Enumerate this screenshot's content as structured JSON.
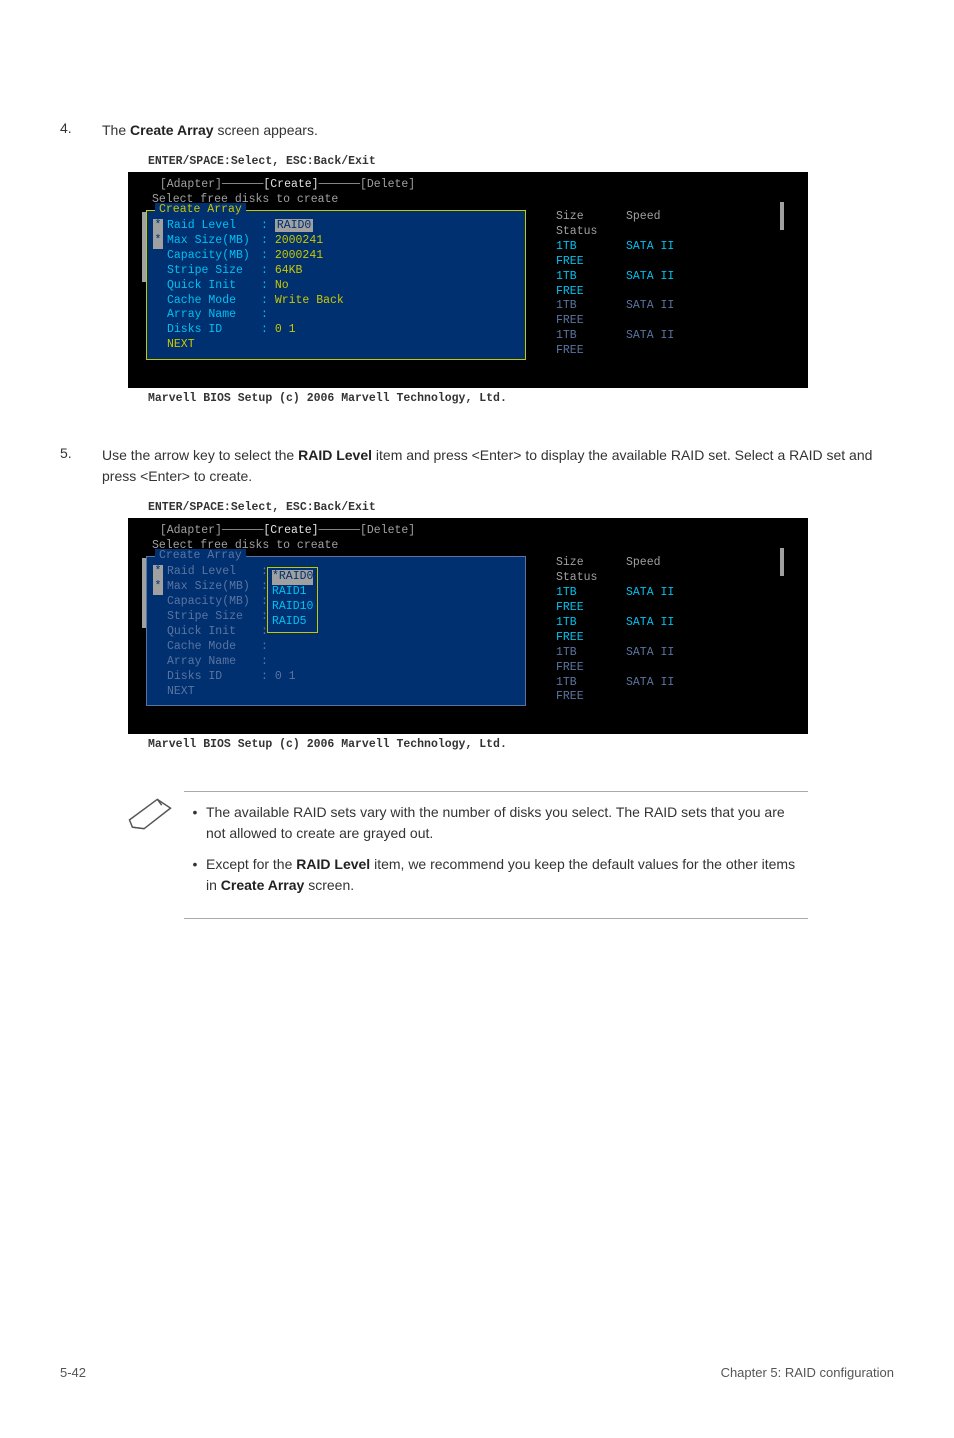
{
  "step4": {
    "num": "4.",
    "text_a": "The",
    "bold": "Create Array",
    "text_b": "screen appears."
  },
  "step5": {
    "num": "5.",
    "text_a": "Use the arrow key to select the",
    "bold": "RAID Level",
    "text_b": "item and press <Enter> to display the available RAID set. Select a RAID set and press <Enter> to create."
  },
  "bios": {
    "header": "ENTER/SPACE:Select, ESC:Back/Exit",
    "tabs": {
      "adapter": "[Adapter]",
      "create": "[Create]",
      "delete": "[Delete]"
    },
    "subtitle": "Select free disks to create",
    "panel_title": "Create Array",
    "fields": {
      "raid_level": "Raid Level",
      "max_size": "Max Size(MB)",
      "capacity": "Capacity(MB)",
      "stripe": "Stripe Size",
      "quick": "Quick Init",
      "cache": "Cache Mode",
      "array": "Array Name",
      "disks": "Disks ID",
      "next": "NEXT"
    },
    "values": {
      "raid_level": "RAID0",
      "max_size": "2000241",
      "capacity": "2000241",
      "stripe": "64KB",
      "quick": "No",
      "cache": "Write Back",
      "array": "",
      "disks": "0 1"
    },
    "dropdown": {
      "o0": "*RAID0",
      "o1": " RAID1",
      "o2": " RAID10",
      "o3": " RAID5"
    },
    "table": {
      "h1": "Size",
      "h2": "Speed",
      "h3": "Status",
      "rows": [
        {
          "c1": "1TB",
          "c2": "SATA II",
          "c3": "FREE",
          "bright": true
        },
        {
          "c1": "1TB",
          "c2": "SATA II",
          "c3": "FREE",
          "bright": true
        },
        {
          "c1": "1TB",
          "c2": "SATA II",
          "c3": "FREE",
          "bright": false
        },
        {
          "c1": "1TB",
          "c2": "SATA II",
          "c3": "FREE",
          "bright": false
        }
      ]
    },
    "footer": "Marvell BIOS Setup (c) 2006 Marvell Technology, Ltd."
  },
  "notes": {
    "n1a": "The available RAID sets vary with the number of disks you select. The RAID sets that you are not allowed to create are grayed out.",
    "n2a": "Except for the",
    "n2b": "RAID Level",
    "n2c": "item, we recommend you keep the default values for the other items in",
    "n2d": "Create Array",
    "n2e": "screen."
  },
  "footer": {
    "left": "5-42",
    "right": "Chapter 5: RAID configuration"
  }
}
